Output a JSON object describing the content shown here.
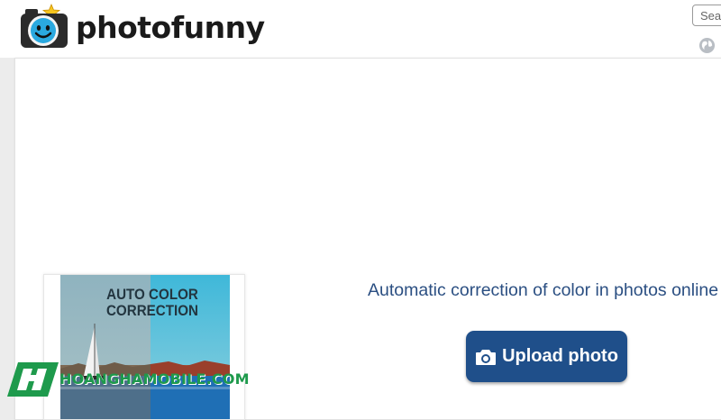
{
  "header": {
    "brand_name": "photofunny",
    "search": {
      "placeholder": "Search"
    }
  },
  "icons": {
    "logo": "camera-smiley-icon",
    "language": "globe-icon",
    "upload": "camera-icon"
  },
  "effect_card": {
    "title": "AUTO COLOR CORRECTION"
  },
  "main": {
    "tagline": "Automatic correction of color in photos online",
    "upload_button_label": "Upload photo"
  },
  "watermark": {
    "text": "HOANGHAMOBILE.COM"
  },
  "colors": {
    "brand_blue": "#1f4f8a",
    "tagline_text": "#2b4f82",
    "logo_face": "#2aa9e0",
    "logo_star": "#f7c51e",
    "watermark_green": "#1e9a4c"
  }
}
